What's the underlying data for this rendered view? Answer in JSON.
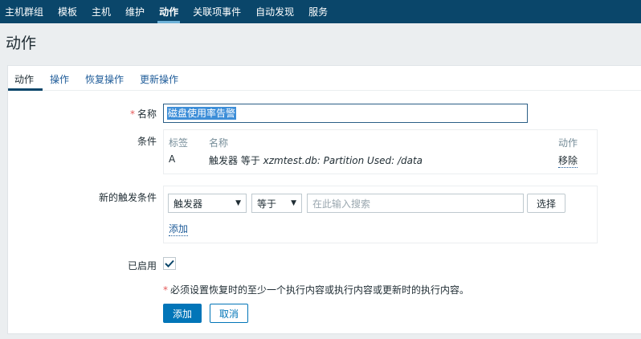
{
  "topnav": {
    "items": [
      "主机群组",
      "模板",
      "主机",
      "维护",
      "动作",
      "关联项事件",
      "自动发现",
      "服务"
    ],
    "active_index": 4
  },
  "page": {
    "title": "动作"
  },
  "tabs": {
    "items": [
      "动作",
      "操作",
      "恢复操作",
      "更新操作"
    ],
    "active_index": 0
  },
  "form": {
    "name": {
      "label": "名称",
      "required_mark": "*",
      "value": "磁盘使用率告警"
    },
    "conditions": {
      "label": "条件",
      "headers": {
        "tag": "标签",
        "name": "名称",
        "action": "动作"
      },
      "rows": [
        {
          "tag": "A",
          "prefix": "触发器 等于 ",
          "detail": "xzmtest.db: Partition Used: /data",
          "action": "移除"
        }
      ]
    },
    "new_condition": {
      "label": "新的触发条件",
      "type_select": "触发器",
      "operator_select": "等于",
      "search_placeholder": "在此输入搜索",
      "select_button": "选择",
      "add_link": "添加"
    },
    "enabled": {
      "label": "已启用",
      "checked": true
    },
    "note": {
      "mark": "*",
      "text": "必须设置恢复时的至少一个执行内容或执行内容或更新时的执行内容。"
    },
    "buttons": {
      "add": "添加",
      "cancel": "取消"
    }
  },
  "colors": {
    "nav_bg": "#0a466a",
    "primary": "#0275b8",
    "link": "#1f5c99",
    "required": "#e45959"
  }
}
